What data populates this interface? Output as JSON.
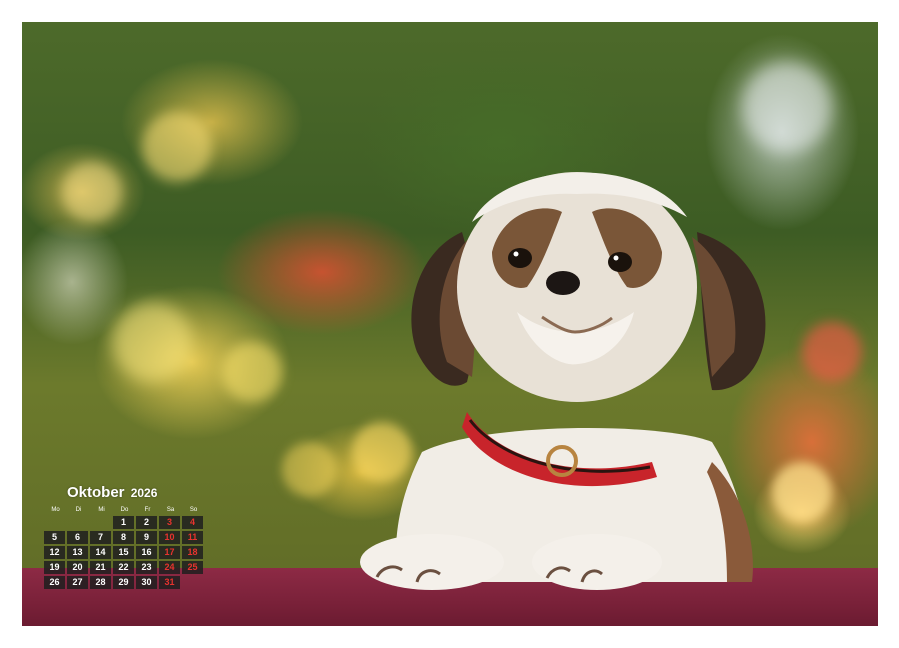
{
  "calendar": {
    "month": "Oktober",
    "year": "2026",
    "weekdays": [
      "Mo",
      "Di",
      "Mi",
      "Do",
      "Fr",
      "Sa",
      "So"
    ],
    "weeks": [
      [
        "",
        "",
        "",
        "1",
        "2",
        "3",
        "4"
      ],
      [
        "5",
        "6",
        "7",
        "8",
        "9",
        "10",
        "11"
      ],
      [
        "12",
        "13",
        "14",
        "15",
        "16",
        "17",
        "18"
      ],
      [
        "19",
        "20",
        "21",
        "22",
        "23",
        "24",
        "25"
      ],
      [
        "26",
        "27",
        "28",
        "29",
        "30",
        "31",
        ""
      ]
    ],
    "weekend_color": "#e8332e"
  },
  "photo": {
    "subject": "shih-tzu-dog",
    "table_color": "#7a2139",
    "collar_color": "#c8242b"
  }
}
